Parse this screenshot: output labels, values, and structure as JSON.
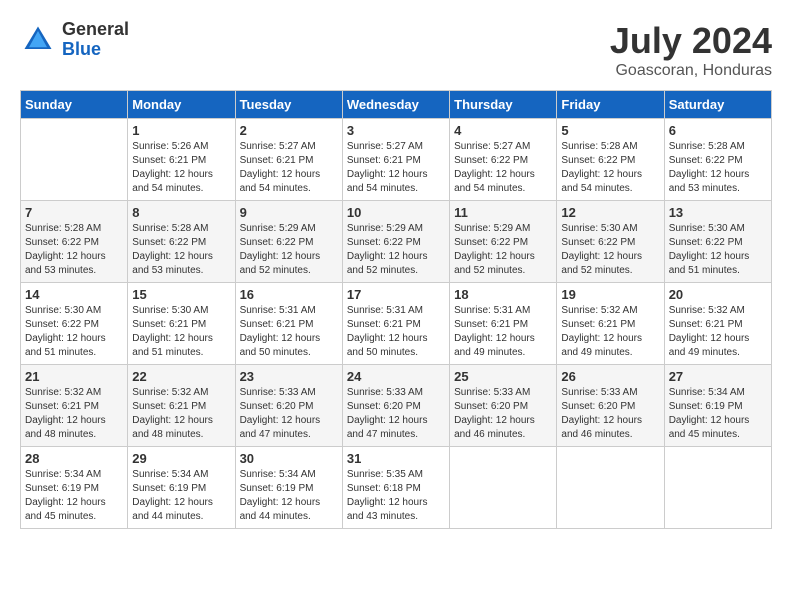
{
  "header": {
    "logo_general": "General",
    "logo_blue": "Blue",
    "month_year": "July 2024",
    "location": "Goascoran, Honduras"
  },
  "calendar": {
    "days_of_week": [
      "Sunday",
      "Monday",
      "Tuesday",
      "Wednesday",
      "Thursday",
      "Friday",
      "Saturday"
    ],
    "weeks": [
      [
        {
          "day": "",
          "sunrise": "",
          "sunset": "",
          "daylight": ""
        },
        {
          "day": "1",
          "sunrise": "Sunrise: 5:26 AM",
          "sunset": "Sunset: 6:21 PM",
          "daylight": "Daylight: 12 hours and 54 minutes."
        },
        {
          "day": "2",
          "sunrise": "Sunrise: 5:27 AM",
          "sunset": "Sunset: 6:21 PM",
          "daylight": "Daylight: 12 hours and 54 minutes."
        },
        {
          "day": "3",
          "sunrise": "Sunrise: 5:27 AM",
          "sunset": "Sunset: 6:21 PM",
          "daylight": "Daylight: 12 hours and 54 minutes."
        },
        {
          "day": "4",
          "sunrise": "Sunrise: 5:27 AM",
          "sunset": "Sunset: 6:22 PM",
          "daylight": "Daylight: 12 hours and 54 minutes."
        },
        {
          "day": "5",
          "sunrise": "Sunrise: 5:28 AM",
          "sunset": "Sunset: 6:22 PM",
          "daylight": "Daylight: 12 hours and 54 minutes."
        },
        {
          "day": "6",
          "sunrise": "Sunrise: 5:28 AM",
          "sunset": "Sunset: 6:22 PM",
          "daylight": "Daylight: 12 hours and 53 minutes."
        }
      ],
      [
        {
          "day": "7",
          "sunrise": "Sunrise: 5:28 AM",
          "sunset": "Sunset: 6:22 PM",
          "daylight": "Daylight: 12 hours and 53 minutes."
        },
        {
          "day": "8",
          "sunrise": "Sunrise: 5:28 AM",
          "sunset": "Sunset: 6:22 PM",
          "daylight": "Daylight: 12 hours and 53 minutes."
        },
        {
          "day": "9",
          "sunrise": "Sunrise: 5:29 AM",
          "sunset": "Sunset: 6:22 PM",
          "daylight": "Daylight: 12 hours and 52 minutes."
        },
        {
          "day": "10",
          "sunrise": "Sunrise: 5:29 AM",
          "sunset": "Sunset: 6:22 PM",
          "daylight": "Daylight: 12 hours and 52 minutes."
        },
        {
          "day": "11",
          "sunrise": "Sunrise: 5:29 AM",
          "sunset": "Sunset: 6:22 PM",
          "daylight": "Daylight: 12 hours and 52 minutes."
        },
        {
          "day": "12",
          "sunrise": "Sunrise: 5:30 AM",
          "sunset": "Sunset: 6:22 PM",
          "daylight": "Daylight: 12 hours and 52 minutes."
        },
        {
          "day": "13",
          "sunrise": "Sunrise: 5:30 AM",
          "sunset": "Sunset: 6:22 PM",
          "daylight": "Daylight: 12 hours and 51 minutes."
        }
      ],
      [
        {
          "day": "14",
          "sunrise": "Sunrise: 5:30 AM",
          "sunset": "Sunset: 6:22 PM",
          "daylight": "Daylight: 12 hours and 51 minutes."
        },
        {
          "day": "15",
          "sunrise": "Sunrise: 5:30 AM",
          "sunset": "Sunset: 6:21 PM",
          "daylight": "Daylight: 12 hours and 51 minutes."
        },
        {
          "day": "16",
          "sunrise": "Sunrise: 5:31 AM",
          "sunset": "Sunset: 6:21 PM",
          "daylight": "Daylight: 12 hours and 50 minutes."
        },
        {
          "day": "17",
          "sunrise": "Sunrise: 5:31 AM",
          "sunset": "Sunset: 6:21 PM",
          "daylight": "Daylight: 12 hours and 50 minutes."
        },
        {
          "day": "18",
          "sunrise": "Sunrise: 5:31 AM",
          "sunset": "Sunset: 6:21 PM",
          "daylight": "Daylight: 12 hours and 49 minutes."
        },
        {
          "day": "19",
          "sunrise": "Sunrise: 5:32 AM",
          "sunset": "Sunset: 6:21 PM",
          "daylight": "Daylight: 12 hours and 49 minutes."
        },
        {
          "day": "20",
          "sunrise": "Sunrise: 5:32 AM",
          "sunset": "Sunset: 6:21 PM",
          "daylight": "Daylight: 12 hours and 49 minutes."
        }
      ],
      [
        {
          "day": "21",
          "sunrise": "Sunrise: 5:32 AM",
          "sunset": "Sunset: 6:21 PM",
          "daylight": "Daylight: 12 hours and 48 minutes."
        },
        {
          "day": "22",
          "sunrise": "Sunrise: 5:32 AM",
          "sunset": "Sunset: 6:21 PM",
          "daylight": "Daylight: 12 hours and 48 minutes."
        },
        {
          "day": "23",
          "sunrise": "Sunrise: 5:33 AM",
          "sunset": "Sunset: 6:20 PM",
          "daylight": "Daylight: 12 hours and 47 minutes."
        },
        {
          "day": "24",
          "sunrise": "Sunrise: 5:33 AM",
          "sunset": "Sunset: 6:20 PM",
          "daylight": "Daylight: 12 hours and 47 minutes."
        },
        {
          "day": "25",
          "sunrise": "Sunrise: 5:33 AM",
          "sunset": "Sunset: 6:20 PM",
          "daylight": "Daylight: 12 hours and 46 minutes."
        },
        {
          "day": "26",
          "sunrise": "Sunrise: 5:33 AM",
          "sunset": "Sunset: 6:20 PM",
          "daylight": "Daylight: 12 hours and 46 minutes."
        },
        {
          "day": "27",
          "sunrise": "Sunrise: 5:34 AM",
          "sunset": "Sunset: 6:19 PM",
          "daylight": "Daylight: 12 hours and 45 minutes."
        }
      ],
      [
        {
          "day": "28",
          "sunrise": "Sunrise: 5:34 AM",
          "sunset": "Sunset: 6:19 PM",
          "daylight": "Daylight: 12 hours and 45 minutes."
        },
        {
          "day": "29",
          "sunrise": "Sunrise: 5:34 AM",
          "sunset": "Sunset: 6:19 PM",
          "daylight": "Daylight: 12 hours and 44 minutes."
        },
        {
          "day": "30",
          "sunrise": "Sunrise: 5:34 AM",
          "sunset": "Sunset: 6:19 PM",
          "daylight": "Daylight: 12 hours and 44 minutes."
        },
        {
          "day": "31",
          "sunrise": "Sunrise: 5:35 AM",
          "sunset": "Sunset: 6:18 PM",
          "daylight": "Daylight: 12 hours and 43 minutes."
        },
        {
          "day": "",
          "sunrise": "",
          "sunset": "",
          "daylight": ""
        },
        {
          "day": "",
          "sunrise": "",
          "sunset": "",
          "daylight": ""
        },
        {
          "day": "",
          "sunrise": "",
          "sunset": "",
          "daylight": ""
        }
      ]
    ]
  }
}
